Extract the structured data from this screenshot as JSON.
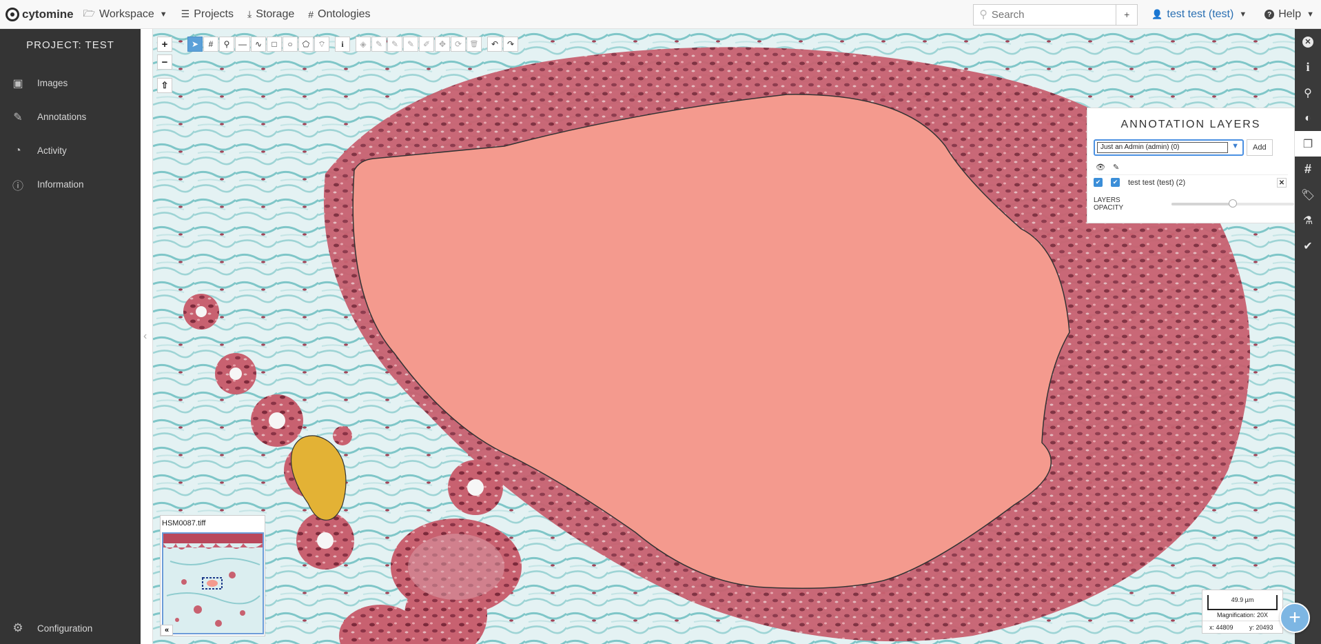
{
  "app": {
    "logo_text": "cytomine"
  },
  "navbar": {
    "workspace_label": "Workspace",
    "projects_label": "Projects",
    "storage_label": "Storage",
    "ontologies_label": "Ontologies",
    "search_placeholder": "Search",
    "add_label": "+",
    "user_label": "test test (test)",
    "help_label": "Help"
  },
  "sidebar": {
    "project_title": "PROJECT: TEST",
    "items": [
      {
        "label": "Images",
        "icon": "images-icon"
      },
      {
        "label": "Annotations",
        "icon": "edit-icon"
      },
      {
        "label": "Activity",
        "icon": "dashboard-icon"
      },
      {
        "label": "Information",
        "icon": "info-icon"
      }
    ],
    "configuration_label": "Configuration"
  },
  "map_controls": {
    "zoom_in": "+",
    "zoom_out": "−",
    "rotate": "⇧"
  },
  "toolbar": {
    "tools": [
      {
        "name": "select-tool",
        "glyph": "➤",
        "state": "active"
      },
      {
        "name": "point-count-tool",
        "glyph": "#",
        "state": "normal"
      },
      {
        "name": "point-tool",
        "glyph": "⚲",
        "state": "normal"
      },
      {
        "name": "line-tool",
        "glyph": "—",
        "state": "normal"
      },
      {
        "name": "freehand-line-tool",
        "glyph": "∿",
        "state": "normal"
      },
      {
        "name": "rectangle-tool",
        "glyph": "□",
        "state": "normal"
      },
      {
        "name": "circle-tool",
        "glyph": "○",
        "state": "normal"
      },
      {
        "name": "polygon-tool",
        "glyph": "⬠",
        "state": "normal"
      },
      {
        "name": "freehand-polygon-tool",
        "glyph": "⌔",
        "state": "normal"
      },
      {
        "name": "info-tool",
        "glyph": "i",
        "state": "normal"
      },
      {
        "name": "fill-tool",
        "glyph": "◈",
        "state": "disabled"
      },
      {
        "name": "edit-tool",
        "glyph": "✎",
        "state": "disabled"
      },
      {
        "name": "correct-add-tool",
        "glyph": "✎",
        "state": "disabled"
      },
      {
        "name": "correct-remove-tool",
        "glyph": "✎",
        "state": "disabled"
      },
      {
        "name": "ruler-tool",
        "glyph": "✐",
        "state": "disabled"
      },
      {
        "name": "move-tool",
        "glyph": "✥",
        "state": "disabled"
      },
      {
        "name": "rotate-tool",
        "glyph": "⟳",
        "state": "disabled"
      },
      {
        "name": "delete-tool",
        "glyph": "🗑",
        "state": "disabled"
      },
      {
        "name": "undo-tool",
        "glyph": "↶",
        "state": "normal"
      },
      {
        "name": "redo-tool",
        "glyph": "↷",
        "state": "normal"
      }
    ]
  },
  "layers_panel": {
    "title": "ANNOTATION LAYERS",
    "selected_layer": "Just an Admin (admin) (0)",
    "add_label": "Add",
    "layers": [
      {
        "label": "test test (test) (2)",
        "visible": true,
        "editable": true
      }
    ],
    "opacity_label": "LAYERS OPACITY",
    "opacity_value": 0.5
  },
  "overview": {
    "filename": "HSM0087.tiff",
    "collapse_label": "«"
  },
  "scale": {
    "length": "49.9 µm",
    "magnification": "Magnification: 20X",
    "x": "x: 44809",
    "y": "y: 20493"
  },
  "right_bar": [
    {
      "name": "close-icon",
      "active": false
    },
    {
      "name": "info-icon",
      "active": false
    },
    {
      "name": "search-icon",
      "active": false
    },
    {
      "name": "contrast-icon",
      "active": false
    },
    {
      "name": "layers-icon",
      "active": true
    },
    {
      "name": "hashtag-icon",
      "active": false
    },
    {
      "name": "tag-icon",
      "active": false
    },
    {
      "name": "microscope-icon",
      "active": false
    },
    {
      "name": "check-circle-icon",
      "active": false
    }
  ],
  "colors": {
    "accent": "#4a90e2",
    "sidebar_bg": "#343434",
    "annotation_red": "#f49a8e",
    "annotation_yellow": "#e3b235",
    "tissue_red": "#b5475a",
    "tissue_cyan": "#7ec7c9"
  }
}
